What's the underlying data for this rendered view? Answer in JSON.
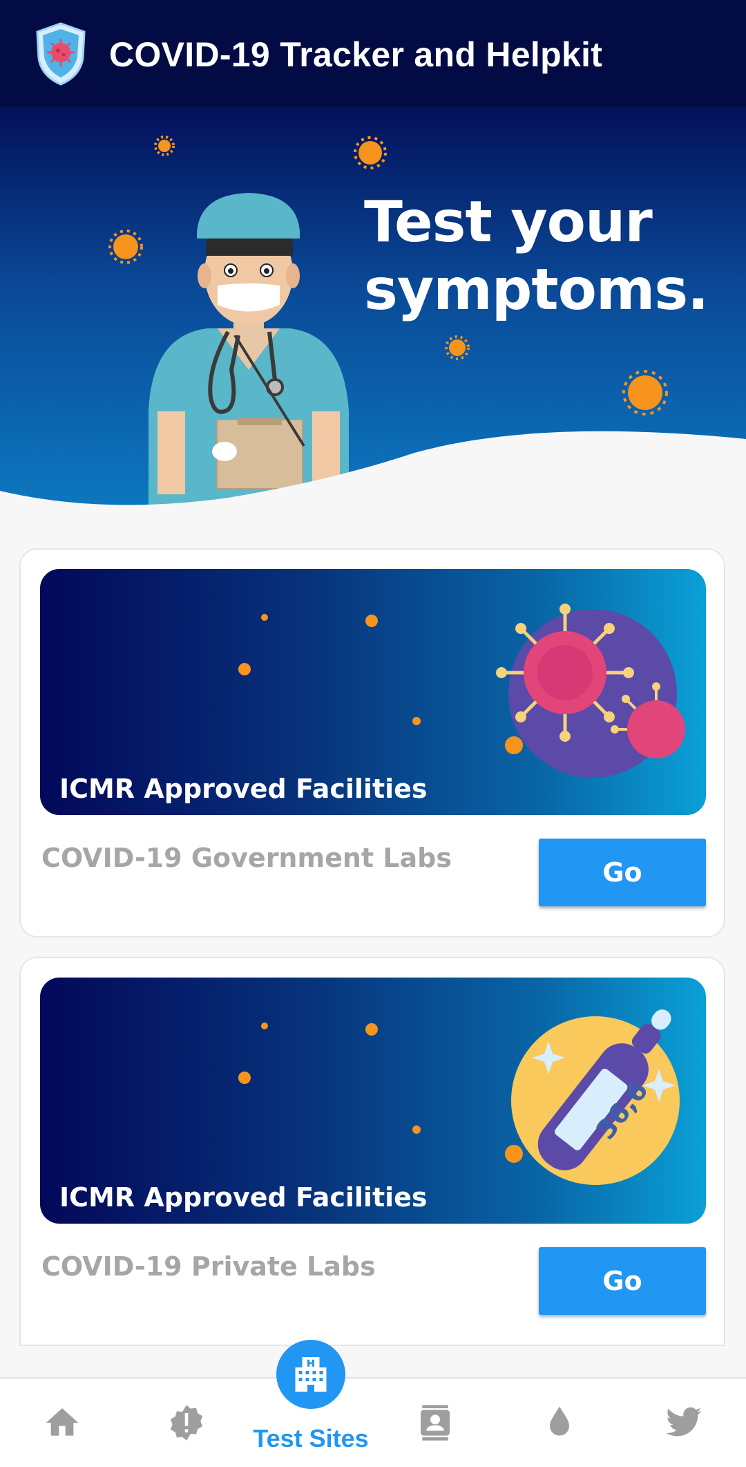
{
  "app": {
    "title": "COVID-19 Tracker and Helpkit",
    "logo_icon": "virus-shield-icon"
  },
  "hero": {
    "headline_line1": "Test your",
    "headline_line2": "symptoms."
  },
  "cards": [
    {
      "banner_label": "ICMR Approved Facilities",
      "lab_name": "COVID-19 Government Labs",
      "button_label": "Go",
      "illustration_icon": "virus-icon"
    },
    {
      "banner_label": "ICMR Approved Facilities",
      "lab_name": "COVID-19 Private Labs",
      "button_label": "Go",
      "illustration_icon": "thermometer-icon",
      "thermometer_reading": "36,6"
    }
  ],
  "bottom_nav": {
    "items": [
      {
        "icon": "home-icon"
      },
      {
        "icon": "alert-badge-icon"
      },
      {
        "icon": "hospital-icon",
        "label": "Test Sites",
        "active": true
      },
      {
        "icon": "contacts-icon"
      },
      {
        "icon": "drop-icon"
      },
      {
        "icon": "twitter-icon"
      }
    ]
  },
  "colors": {
    "appbar": "#030b45",
    "accent": "#2196f3",
    "muted_text": "#a6a6a6",
    "virus_orange": "#f7941d"
  }
}
